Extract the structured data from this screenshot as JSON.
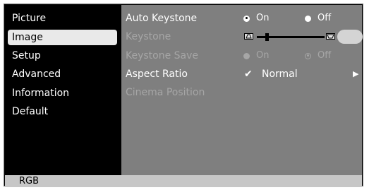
{
  "sidebar": {
    "items": [
      {
        "label": "Picture",
        "selected": false
      },
      {
        "label": "Image",
        "selected": true
      },
      {
        "label": "Setup",
        "selected": false
      },
      {
        "label": "Advanced",
        "selected": false
      },
      {
        "label": "Information",
        "selected": false
      },
      {
        "label": "Default",
        "selected": false
      }
    ]
  },
  "settings": {
    "auto_keystone": {
      "label": "Auto Keystone",
      "on_label": "On",
      "off_label": "Off",
      "value": "On"
    },
    "keystone": {
      "label": "Keystone",
      "slider_level": 0.13
    },
    "keystone_save": {
      "label": "Keystone Save",
      "on_label": "On",
      "off_label": "Off",
      "value": "On"
    },
    "aspect_ratio": {
      "label": "Aspect Ratio",
      "value": "Normal"
    },
    "cinema_position": {
      "label": "Cinema Position"
    }
  },
  "status_bar": {
    "source": "RGB"
  },
  "colors": {
    "panel": "#7f7f7f",
    "sidebar": "#000000",
    "selected_item": "#e9e9e9",
    "status_bar": "#c7c7c7",
    "disabled_text": "#a6a6a6"
  }
}
